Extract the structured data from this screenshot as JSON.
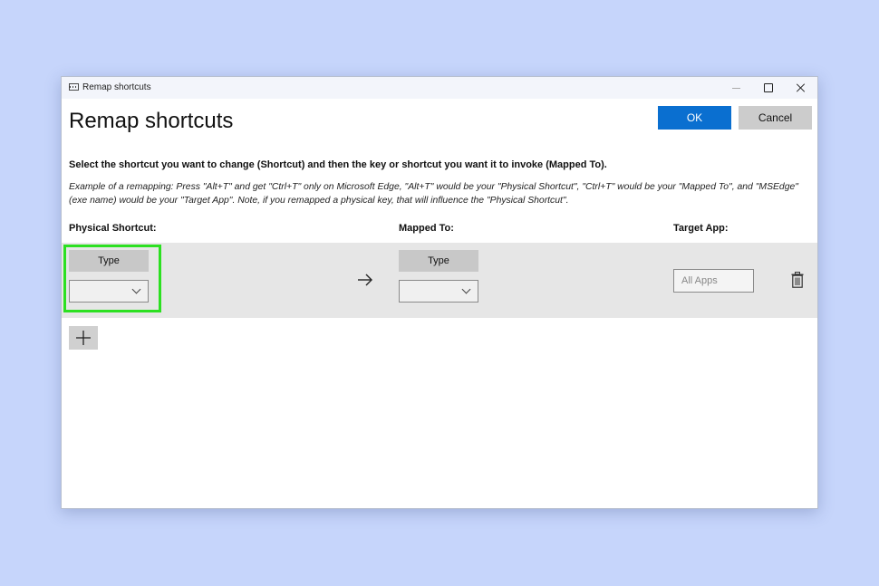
{
  "window": {
    "title": "Remap shortcuts"
  },
  "dialog": {
    "title": "Remap shortcuts",
    "ok_label": "OK",
    "cancel_label": "Cancel",
    "instruction": "Select the shortcut you want to change (Shortcut) and then the key or shortcut you want it to invoke (Mapped To).",
    "example": "Example of a remapping: Press \"Alt+T\" and get \"Ctrl+T\" only on Microsoft Edge, \"Alt+T\" would be your \"Physical Shortcut\", \"Ctrl+T\" would be your \"Mapped To\", and \"MSEdge\" (exe name) would be your \"Target App\". Note, if you remapped a physical key, that will influence the \"Physical Shortcut\"."
  },
  "columns": {
    "physical": "Physical Shortcut:",
    "mapped": "Mapped To:",
    "target": "Target App:"
  },
  "row": {
    "physical_type_label": "Type",
    "mapped_type_label": "Type",
    "target_placeholder": "All Apps"
  },
  "colors": {
    "accent": "#0a6fd0",
    "highlight": "#2ce021",
    "background": "#c6d5fb"
  },
  "icons": [
    "app-icon",
    "minimize-icon",
    "maximize-icon",
    "close-icon",
    "chevron-down-icon",
    "arrow-right-icon",
    "trash-icon",
    "plus-icon"
  ]
}
